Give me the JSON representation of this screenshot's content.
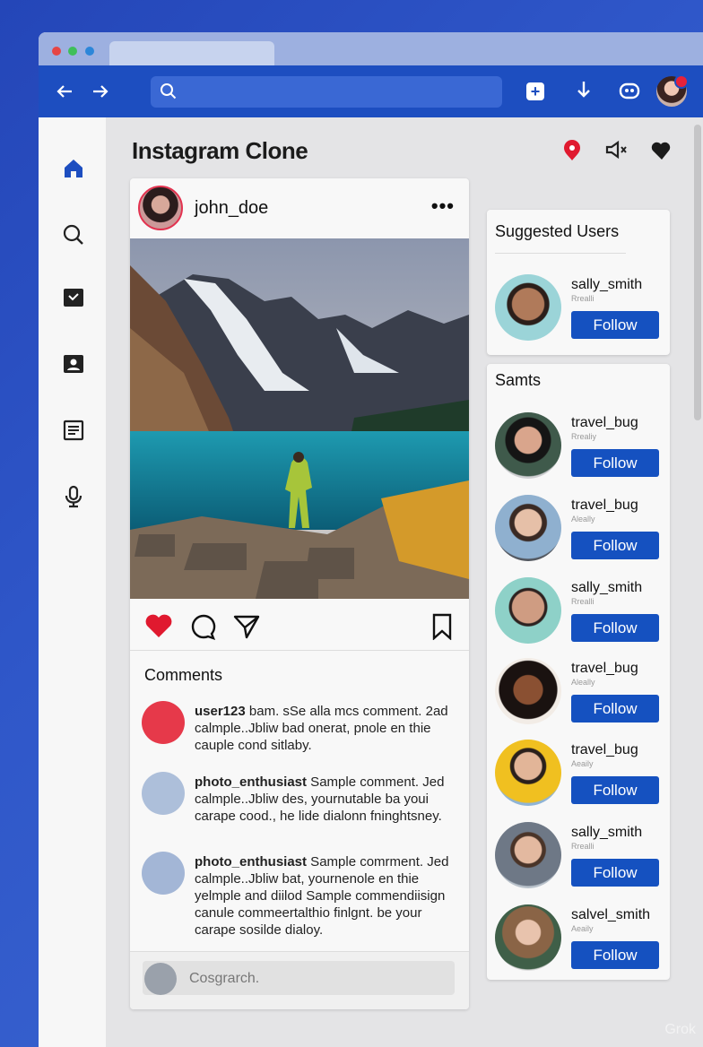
{
  "browser": {
    "search_placeholder": "",
    "icons": [
      "back-arrow-icon",
      "forward-arrow-icon",
      "search-icon",
      "new-tab-icon",
      "download-icon",
      "extensions-icon",
      "profile-avatar"
    ]
  },
  "page": {
    "title": "Instagram Clone"
  },
  "sidebar": {
    "items": [
      "home-icon",
      "search-icon",
      "reels-icon",
      "profile-icon",
      "feed-icon",
      "microphone-icon"
    ]
  },
  "post": {
    "username": "john_doe",
    "more": "•••",
    "comments_title": "Comments",
    "comments": [
      {
        "user": "user123",
        "text": " bam. sSe alla mcs comment. 2ad calmple..Jbliw bad onerat, pnole en thie cauple cond sitlaby."
      },
      {
        "user": "photo_enthusiast",
        "text": " Sample comment. Jed calmple..Jbliw des, yournutable ba youi carape cood., he lide dialonn fninghtsney."
      },
      {
        "user": "photo_enthusiast",
        "text": " Sample comrment. Jed calmple..Jbliw bat, yournenole en thie yelmple and diilod Sample commendiisign canule commeertalthio finlgnt. be your carape sosilde dialoy."
      }
    ],
    "add_comment_placeholder": "Cosgrarch."
  },
  "suggested": {
    "title": "Suggested Users",
    "users": [
      {
        "name": "sally_smith",
        "sub": "Rrealli"
      }
    ],
    "follow_label": "Follow"
  },
  "samts": {
    "title": "Samts",
    "users": [
      {
        "name": "travel_bug",
        "sub": "Rrealiy"
      },
      {
        "name": "travel_bug",
        "sub": "Aleally"
      },
      {
        "name": "sally_smith",
        "sub": "Rrealli"
      },
      {
        "name": "travel_bug",
        "sub": "Aleally"
      },
      {
        "name": "travel_bug",
        "sub": "Aeaily"
      },
      {
        "name": "sally_smith",
        "sub": "Rrealli"
      },
      {
        "name": "salvel_smith",
        "sub": "Aeaily"
      }
    ],
    "follow_label": "Follow"
  },
  "watermark": "Grok",
  "colors": {
    "accent": "#1551c0",
    "toolbar": "#1d4ec0",
    "like": "#e0192f"
  }
}
